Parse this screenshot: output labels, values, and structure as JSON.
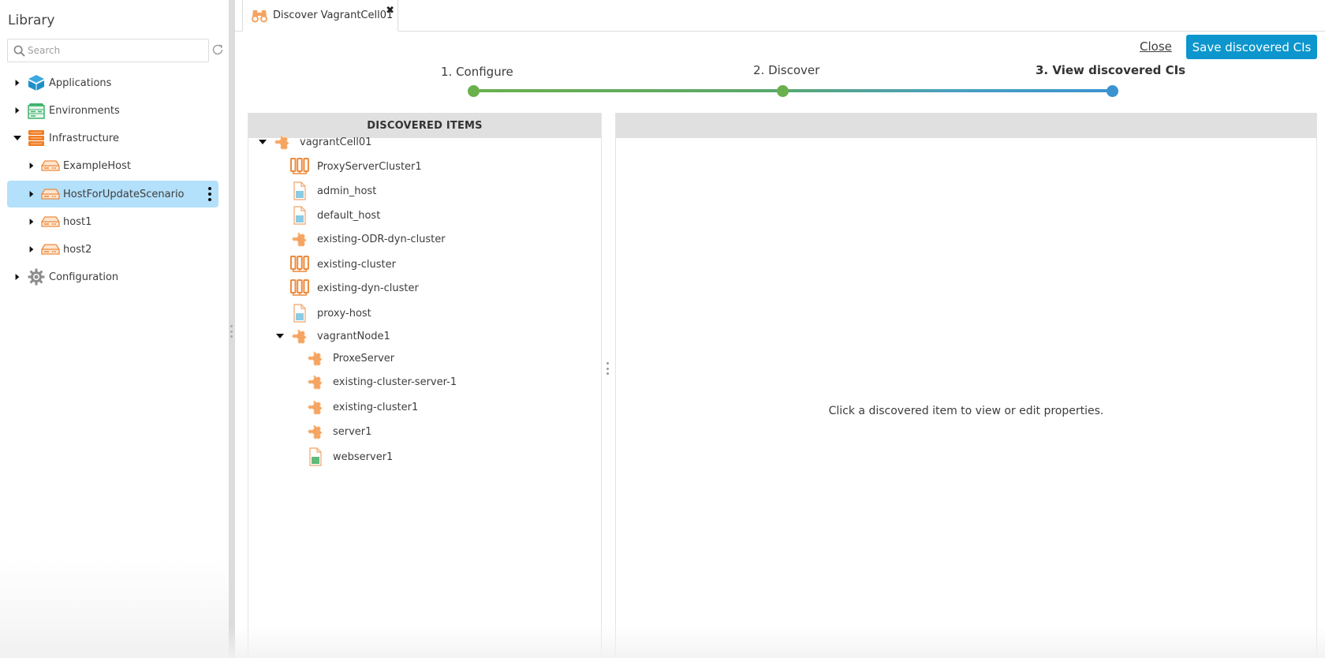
{
  "sidebar": {
    "title": "Library",
    "search": {
      "placeholder": "Search",
      "value": ""
    },
    "items": [
      {
        "label": "Applications",
        "icon": "applications-icon",
        "expanded": false,
        "level": 0
      },
      {
        "label": "Environments",
        "icon": "environments-icon",
        "expanded": false,
        "level": 0
      },
      {
        "label": "Infrastructure",
        "icon": "infrastructure-icon",
        "expanded": true,
        "level": 0
      },
      {
        "label": "ExampleHost",
        "icon": "host-icon",
        "expanded": false,
        "level": 1
      },
      {
        "label": "HostForUpdateScenario",
        "icon": "host-icon",
        "expanded": false,
        "level": 1,
        "selected": true
      },
      {
        "label": "host1",
        "icon": "host-icon",
        "expanded": false,
        "level": 1
      },
      {
        "label": "host2",
        "icon": "host-icon",
        "expanded": false,
        "level": 1
      },
      {
        "label": "Configuration",
        "icon": "gear-icon",
        "expanded": false,
        "level": 0
      }
    ]
  },
  "tab": {
    "label": "Discover VagrantCell01",
    "icon": "binoculars-icon"
  },
  "actions": {
    "close_label": "Close",
    "save_label": "Save discovered CIs"
  },
  "stepper": {
    "steps": [
      {
        "label": "1. Configure",
        "state": "done"
      },
      {
        "label": "2. Discover",
        "state": "done"
      },
      {
        "label": "3. View discovered CIs",
        "state": "active"
      }
    ],
    "colors": {
      "done": "#6ab04c",
      "active": "#3b93d0"
    }
  },
  "discovered": {
    "header": "DISCOVERED ITEMS",
    "items": [
      {
        "label": "vagrantCell01",
        "icon": "puzzle-icon",
        "level": 0,
        "expanded": true
      },
      {
        "label": "ProxyServerCluster1",
        "icon": "cluster-icon",
        "level": 1
      },
      {
        "label": "admin_host",
        "icon": "virtual-host-icon",
        "level": 1
      },
      {
        "label": "default_host",
        "icon": "virtual-host-icon",
        "level": 1
      },
      {
        "label": "existing-ODR-dyn-cluster",
        "icon": "puzzle-icon",
        "level": 1
      },
      {
        "label": "existing-cluster",
        "icon": "cluster-icon",
        "level": 1
      },
      {
        "label": "existing-dyn-cluster",
        "icon": "cluster-icon",
        "level": 1
      },
      {
        "label": "proxy-host",
        "icon": "virtual-host-icon",
        "level": 1
      },
      {
        "label": "vagrantNode1",
        "icon": "puzzle-icon",
        "level": 1,
        "expanded": true
      },
      {
        "label": "ProxeServer",
        "icon": "puzzle-icon",
        "level": 2
      },
      {
        "label": "existing-cluster-server-1",
        "icon": "puzzle-icon",
        "level": 2
      },
      {
        "label": "existing-cluster1",
        "icon": "puzzle-icon",
        "level": 2
      },
      {
        "label": "server1",
        "icon": "puzzle-icon",
        "level": 2
      },
      {
        "label": "webserver1",
        "icon": "webserver-icon",
        "level": 2
      }
    ]
  },
  "details": {
    "hint": "Click a discovered item to view or edit properties."
  }
}
